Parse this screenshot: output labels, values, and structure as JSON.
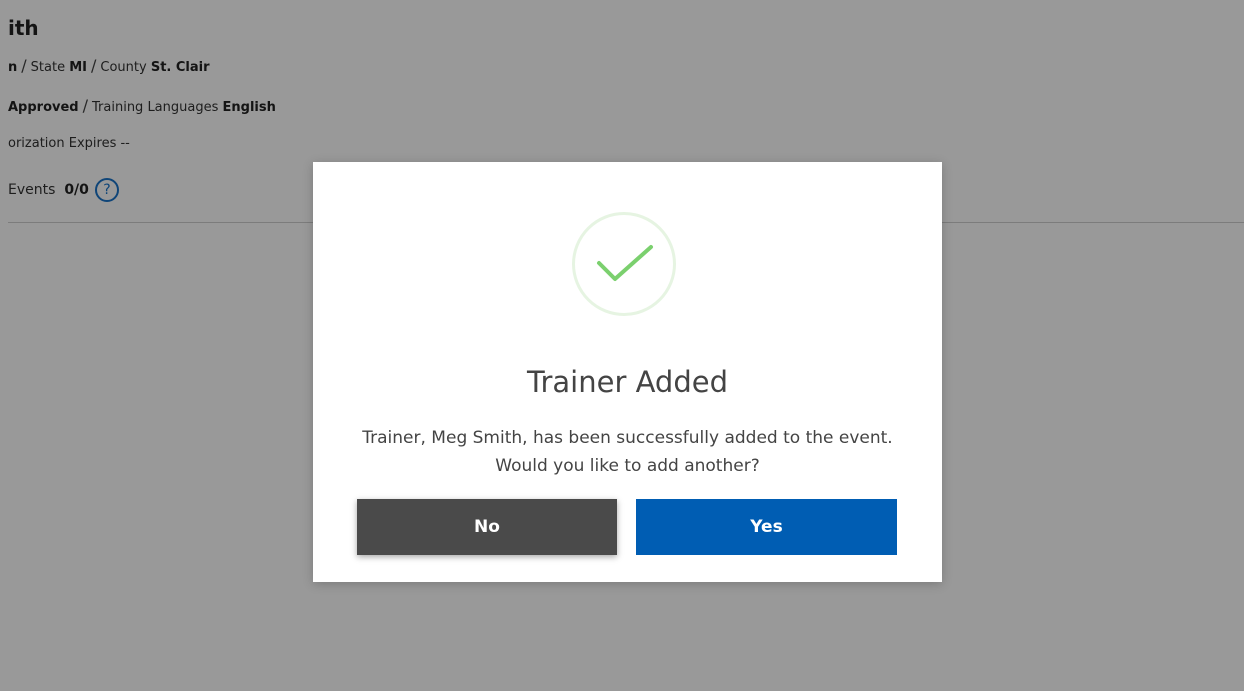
{
  "background_page": {
    "title": "ith",
    "row1": {
      "prefix": "n",
      "state_label": "State",
      "state_value": "MI",
      "county_label": "County",
      "county_value": "St. Clair"
    },
    "row2": {
      "status_value": "Approved",
      "languages_label": "Training Languages",
      "languages_value": "English"
    },
    "row3": {
      "label": "orization Expires",
      "value": "--"
    },
    "row4": {
      "label": "Events",
      "value": "0/0",
      "help_icon": "?"
    }
  },
  "modal": {
    "icon": "checkmark-icon",
    "title": "Trainer Added",
    "message_line1": "Trainer, Meg Smith, has been successfully added to the event.",
    "message_line2": "Would you like to add another?",
    "no_label": "No",
    "yes_label": "Yes"
  },
  "colors": {
    "overlay": "#999999",
    "primary": "#005db3",
    "secondary": "#4a4a4a",
    "success": "#7bd06e"
  }
}
